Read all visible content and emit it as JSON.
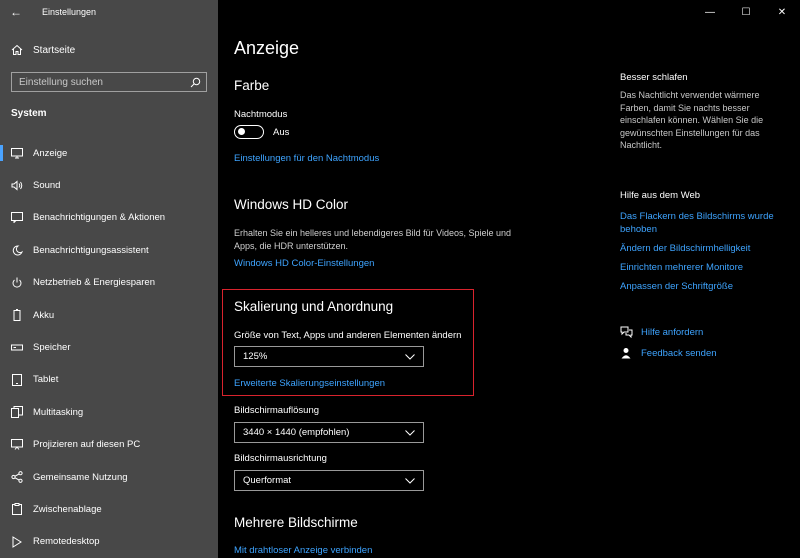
{
  "window": {
    "title": "Einstellungen",
    "back_glyph": "←",
    "minimize_glyph": "—",
    "maximize_glyph": "☐",
    "close_glyph": "✕"
  },
  "sidebar": {
    "home_label": "Startseite",
    "search_placeholder": "Einstellung suchen",
    "section": "System",
    "items": [
      {
        "label": "Anzeige",
        "icon": "monitor-icon",
        "active": true
      },
      {
        "label": "Sound",
        "icon": "speaker-icon"
      },
      {
        "label": "Benachrichtigungen & Aktionen",
        "icon": "notification-icon"
      },
      {
        "label": "Benachrichtigungsassistent",
        "icon": "moon-icon"
      },
      {
        "label": "Netzbetrieb & Energiesparen",
        "icon": "power-icon"
      },
      {
        "label": "Akku",
        "icon": "battery-icon"
      },
      {
        "label": "Speicher",
        "icon": "storage-icon"
      },
      {
        "label": "Tablet",
        "icon": "tablet-icon"
      },
      {
        "label": "Multitasking",
        "icon": "multitasking-icon"
      },
      {
        "label": "Projizieren auf diesen PC",
        "icon": "projector-icon"
      },
      {
        "label": "Gemeinsame Nutzung",
        "icon": "share-icon"
      },
      {
        "label": "Zwischenablage",
        "icon": "clipboard-icon"
      },
      {
        "label": "Remotedesktop",
        "icon": "remote-desktop-icon"
      }
    ]
  },
  "main": {
    "title": "Anzeige",
    "farbe": {
      "heading": "Farbe",
      "nightmode_label": "Nachtmodus",
      "nightmode_state": "Aus",
      "nightmode_link": "Einstellungen für den Nachtmodus"
    },
    "hdr": {
      "heading": "Windows HD Color",
      "desc": "Erhalten Sie ein helleres und lebendigeres Bild für Videos, Spiele und Apps, die HDR unterstützen.",
      "link": "Windows HD Color-Einstellungen"
    },
    "scaling": {
      "heading": "Skalierung und Anordnung",
      "size_label": "Größe von Text, Apps und anderen Elementen ändern",
      "size_value": "125%",
      "advanced_link": "Erweiterte Skalierungseinstellungen",
      "resolution_label": "Bildschirmauflösung",
      "resolution_value": "3440 × 1440 (empfohlen)",
      "orientation_label": "Bildschirmausrichtung",
      "orientation_value": "Querformat"
    },
    "multi": {
      "heading": "Mehrere Bildschirme",
      "link": "Mit drahtloser Anzeige verbinden"
    }
  },
  "right_panel": {
    "sleep_title": "Besser schlafen",
    "sleep_desc": "Das Nachtlicht verwendet wärmere Farben, damit Sie nachts besser einschlafen können. Wählen Sie die gewünschten Einstellungen für das Nachtlicht.",
    "help_title": "Hilfe aus dem Web",
    "help_links": [
      "Das Flackern des Bildschirms wurde behoben",
      "Ändern der Bildschirmhelligkeit",
      "Einrichten mehrerer Monitore",
      "Anpassen der Schriftgröße"
    ],
    "get_help": "Hilfe anfordern",
    "feedback": "Feedback senden"
  },
  "colors": {
    "accent": "#3ea4ff",
    "highlight": "#d9232d",
    "sidebar_bg": "#484848"
  }
}
